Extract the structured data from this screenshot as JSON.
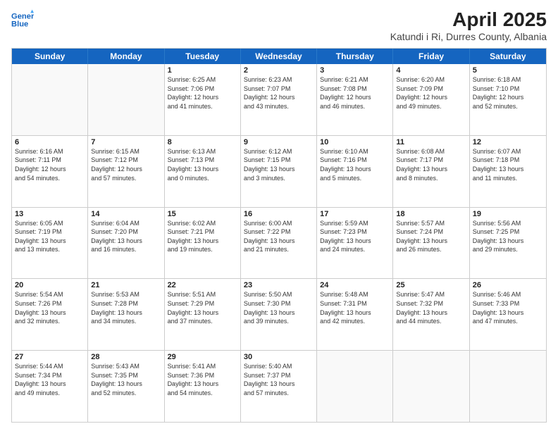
{
  "header": {
    "logo_line1": "General",
    "logo_line2": "Blue",
    "main_title": "April 2025",
    "subtitle": "Katundi i Ri, Durres County, Albania"
  },
  "weekdays": [
    "Sunday",
    "Monday",
    "Tuesday",
    "Wednesday",
    "Thursday",
    "Friday",
    "Saturday"
  ],
  "rows": [
    [
      {
        "day": "",
        "info": ""
      },
      {
        "day": "",
        "info": ""
      },
      {
        "day": "1",
        "info": "Sunrise: 6:25 AM\nSunset: 7:06 PM\nDaylight: 12 hours\nand 41 minutes."
      },
      {
        "day": "2",
        "info": "Sunrise: 6:23 AM\nSunset: 7:07 PM\nDaylight: 12 hours\nand 43 minutes."
      },
      {
        "day": "3",
        "info": "Sunrise: 6:21 AM\nSunset: 7:08 PM\nDaylight: 12 hours\nand 46 minutes."
      },
      {
        "day": "4",
        "info": "Sunrise: 6:20 AM\nSunset: 7:09 PM\nDaylight: 12 hours\nand 49 minutes."
      },
      {
        "day": "5",
        "info": "Sunrise: 6:18 AM\nSunset: 7:10 PM\nDaylight: 12 hours\nand 52 minutes."
      }
    ],
    [
      {
        "day": "6",
        "info": "Sunrise: 6:16 AM\nSunset: 7:11 PM\nDaylight: 12 hours\nand 54 minutes."
      },
      {
        "day": "7",
        "info": "Sunrise: 6:15 AM\nSunset: 7:12 PM\nDaylight: 12 hours\nand 57 minutes."
      },
      {
        "day": "8",
        "info": "Sunrise: 6:13 AM\nSunset: 7:13 PM\nDaylight: 13 hours\nand 0 minutes."
      },
      {
        "day": "9",
        "info": "Sunrise: 6:12 AM\nSunset: 7:15 PM\nDaylight: 13 hours\nand 3 minutes."
      },
      {
        "day": "10",
        "info": "Sunrise: 6:10 AM\nSunset: 7:16 PM\nDaylight: 13 hours\nand 5 minutes."
      },
      {
        "day": "11",
        "info": "Sunrise: 6:08 AM\nSunset: 7:17 PM\nDaylight: 13 hours\nand 8 minutes."
      },
      {
        "day": "12",
        "info": "Sunrise: 6:07 AM\nSunset: 7:18 PM\nDaylight: 13 hours\nand 11 minutes."
      }
    ],
    [
      {
        "day": "13",
        "info": "Sunrise: 6:05 AM\nSunset: 7:19 PM\nDaylight: 13 hours\nand 13 minutes."
      },
      {
        "day": "14",
        "info": "Sunrise: 6:04 AM\nSunset: 7:20 PM\nDaylight: 13 hours\nand 16 minutes."
      },
      {
        "day": "15",
        "info": "Sunrise: 6:02 AM\nSunset: 7:21 PM\nDaylight: 13 hours\nand 19 minutes."
      },
      {
        "day": "16",
        "info": "Sunrise: 6:00 AM\nSunset: 7:22 PM\nDaylight: 13 hours\nand 21 minutes."
      },
      {
        "day": "17",
        "info": "Sunrise: 5:59 AM\nSunset: 7:23 PM\nDaylight: 13 hours\nand 24 minutes."
      },
      {
        "day": "18",
        "info": "Sunrise: 5:57 AM\nSunset: 7:24 PM\nDaylight: 13 hours\nand 26 minutes."
      },
      {
        "day": "19",
        "info": "Sunrise: 5:56 AM\nSunset: 7:25 PM\nDaylight: 13 hours\nand 29 minutes."
      }
    ],
    [
      {
        "day": "20",
        "info": "Sunrise: 5:54 AM\nSunset: 7:26 PM\nDaylight: 13 hours\nand 32 minutes."
      },
      {
        "day": "21",
        "info": "Sunrise: 5:53 AM\nSunset: 7:28 PM\nDaylight: 13 hours\nand 34 minutes."
      },
      {
        "day": "22",
        "info": "Sunrise: 5:51 AM\nSunset: 7:29 PM\nDaylight: 13 hours\nand 37 minutes."
      },
      {
        "day": "23",
        "info": "Sunrise: 5:50 AM\nSunset: 7:30 PM\nDaylight: 13 hours\nand 39 minutes."
      },
      {
        "day": "24",
        "info": "Sunrise: 5:48 AM\nSunset: 7:31 PM\nDaylight: 13 hours\nand 42 minutes."
      },
      {
        "day": "25",
        "info": "Sunrise: 5:47 AM\nSunset: 7:32 PM\nDaylight: 13 hours\nand 44 minutes."
      },
      {
        "day": "26",
        "info": "Sunrise: 5:46 AM\nSunset: 7:33 PM\nDaylight: 13 hours\nand 47 minutes."
      }
    ],
    [
      {
        "day": "27",
        "info": "Sunrise: 5:44 AM\nSunset: 7:34 PM\nDaylight: 13 hours\nand 49 minutes."
      },
      {
        "day": "28",
        "info": "Sunrise: 5:43 AM\nSunset: 7:35 PM\nDaylight: 13 hours\nand 52 minutes."
      },
      {
        "day": "29",
        "info": "Sunrise: 5:41 AM\nSunset: 7:36 PM\nDaylight: 13 hours\nand 54 minutes."
      },
      {
        "day": "30",
        "info": "Sunrise: 5:40 AM\nSunset: 7:37 PM\nDaylight: 13 hours\nand 57 minutes."
      },
      {
        "day": "",
        "info": ""
      },
      {
        "day": "",
        "info": ""
      },
      {
        "day": "",
        "info": ""
      }
    ]
  ]
}
